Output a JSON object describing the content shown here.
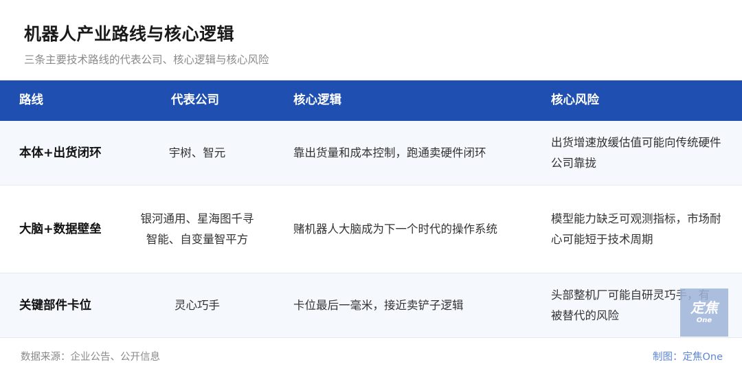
{
  "header": {
    "title": "机器人产业路线与核心逻辑",
    "subtitle": "三条主要技术路线的代表公司、核心逻辑与核心风险"
  },
  "table": {
    "columns": [
      "路线",
      "代表公司",
      "核心逻辑",
      "核心风险"
    ],
    "rows": [
      {
        "route": "本体+出货闭环",
        "company": "宇树、智元",
        "logic": "靠出货量和成本控制，跑通卖硬件闭环",
        "risk": "出货增速放缓估值可能向传统硬件公司靠拢"
      },
      {
        "route": "大脑+数据壁垒",
        "company": "银河通用、星海图千寻智能、自变量智平方",
        "logic": "赌机器人大脑成为下一个时代的操作系统",
        "risk": "模型能力缺乏可观测指标，市场耐心可能短于技术周期"
      },
      {
        "route": "关键部件卡位",
        "company": "灵心巧手",
        "logic": "卡位最后一毫米，接近卖铲子逻辑",
        "risk": "头部整机厂可能自研灵巧手，有被替代的风险"
      }
    ]
  },
  "footer": {
    "source": "数据来源：企业公告、公开信息",
    "credit": "制图：定焦One"
  },
  "watermark": {
    "logo_text": "定焦",
    "logo_sub": "One"
  },
  "colors": {
    "header_bg": "#1f4fb0",
    "row_alt_bg": "#f5f8fd",
    "credit_text": "#5e86d6"
  }
}
